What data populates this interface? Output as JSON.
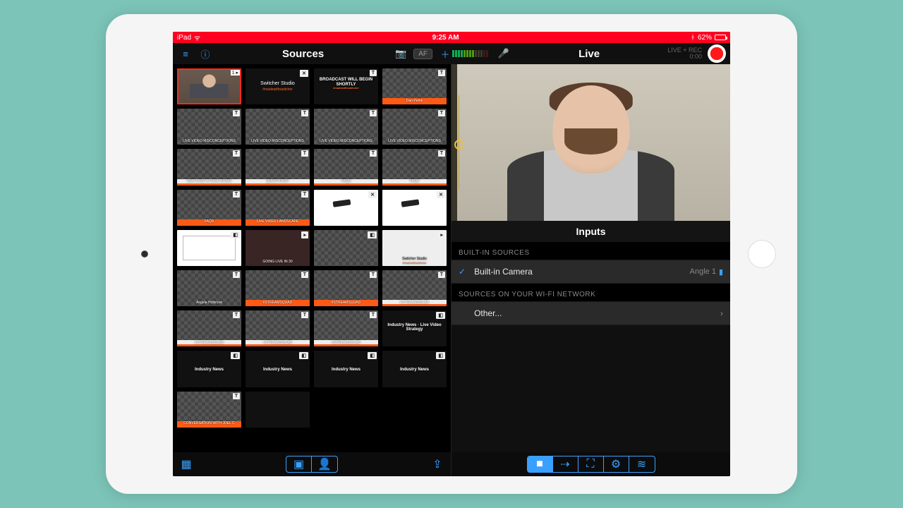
{
  "status_bar": {
    "device": "iPad",
    "time": "9:25 AM",
    "battery_pct": "62%",
    "bluetooth": true
  },
  "topbar": {
    "left_title": "Sources",
    "right_title": "Live",
    "af_label": "AF",
    "rec_label": "LIVE + REC",
    "rec_time": "0:00"
  },
  "thumbs": [
    {
      "kind": "person",
      "badge": "1 ▸",
      "selected": true
    },
    {
      "kind": "logo",
      "badge": "✕",
      "text": "Switcher Studio",
      "sub": "#madewithswitcher"
    },
    {
      "kind": "black",
      "badge": "T",
      "text": "BROADCAST WILL BEGIN SHORTLY",
      "sub": "#madewithswitcher"
    },
    {
      "kind": "checker",
      "badge": "T",
      "strip": "orange",
      "text": "Dan Petrik"
    },
    {
      "kind": "checker",
      "badge": "T",
      "text": "LIVE VIDEO MISCONCEPTIONS"
    },
    {
      "kind": "checker",
      "badge": "T",
      "text": "LIVE VIDEO MISCONCEPTIONS"
    },
    {
      "kind": "checker",
      "badge": "T",
      "text": "LIVE VIDEO MISCONCEPTIONS"
    },
    {
      "kind": "checker",
      "badge": "T",
      "text": "LIVE VIDEO MISCONCEPTIONS"
    },
    {
      "kind": "checker",
      "badge": "T",
      "strip": "white",
      "text": "SWITCHER STUDIO DEMO"
    },
    {
      "kind": "checker",
      "badge": "T",
      "strip": "white",
      "text": "QUESTIONS?"
    },
    {
      "kind": "checker",
      "badge": "T",
      "strip": "white",
      "text": "FAQS"
    },
    {
      "kind": "checker",
      "badge": "T",
      "strip": "white",
      "text": "FAQS"
    },
    {
      "kind": "checker",
      "badge": "T",
      "strip": "orange",
      "text": "FAQS"
    },
    {
      "kind": "checker",
      "badge": "T",
      "strip": "orange",
      "text": "LIVE VIDEO LANDSCAPE"
    },
    {
      "kind": "dev",
      "badge": "✕"
    },
    {
      "kind": "dev",
      "badge": "✕"
    },
    {
      "kind": "diag",
      "badge": "◧"
    },
    {
      "kind": "video",
      "badge": "▸",
      "text": "GOING LIVE IN 30"
    },
    {
      "kind": "checker",
      "badge": "◧"
    },
    {
      "kind": "white",
      "badge": "▸",
      "text": "Switcher Studio",
      "sub": "#madewithswitcher"
    },
    {
      "kind": "checker",
      "badge": "T",
      "text": "Angela Holbrook"
    },
    {
      "kind": "checker",
      "badge": "T",
      "strip": "orange",
      "text": "#STREAMSQUAD"
    },
    {
      "kind": "checker",
      "badge": "T",
      "strip": "orange",
      "text": "#STREAMSQUAD"
    },
    {
      "kind": "checker",
      "badge": "T",
      "strip": "white",
      "text": "#STREAMSQUAD"
    },
    {
      "kind": "checker",
      "badge": "T",
      "strip": "white",
      "text": "#STREAMSQUAD"
    },
    {
      "kind": "checker",
      "badge": "T",
      "strip": "white",
      "text": "#STREAMSQUAD"
    },
    {
      "kind": "checker",
      "badge": "T",
      "strip": "white",
      "text": "#STREAMSQUAD"
    },
    {
      "kind": "black",
      "badge": "◧",
      "text": "Industry News · Live Video Strategy"
    },
    {
      "kind": "black",
      "badge": "◧",
      "text": "Industry News"
    },
    {
      "kind": "black",
      "badge": "◧",
      "text": "Industry News"
    },
    {
      "kind": "black",
      "badge": "◧",
      "text": "Industry News"
    },
    {
      "kind": "black",
      "badge": "◧",
      "text": "Industry News"
    },
    {
      "kind": "checker",
      "badge": "T",
      "strip": "orange",
      "text": "CONVERSATION WITH JOEL C"
    },
    {
      "kind": "black"
    }
  ],
  "inputs": {
    "title": "Inputs",
    "section1": "BUILT-IN SOURCES",
    "row1_label": "Built-in Camera",
    "row1_meta": "Angle 1",
    "section2": "SOURCES ON YOUR WI-FI NETWORK",
    "row2_label": "Other..."
  },
  "icons": {
    "menu": "≡",
    "info": "ⓘ",
    "camera": "📷",
    "plus": "＋",
    "mic": "🎤",
    "grid": "▦",
    "pip": "▣",
    "person": "👤",
    "share": "⇪",
    "cam": "■",
    "out": "⇢",
    "full": "⛶",
    "sliders": "⚙",
    "wave": "≋",
    "chev": "›",
    "camchip": "▮"
  }
}
